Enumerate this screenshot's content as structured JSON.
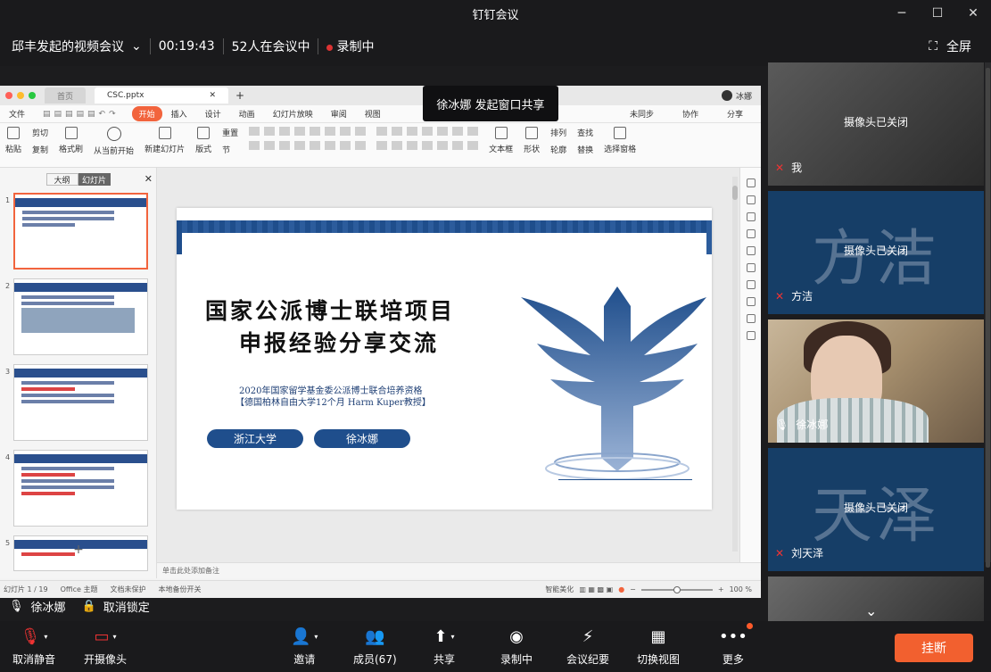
{
  "window": {
    "title": "钉钉会议",
    "controls": [
      "minimize-icon",
      "maximize-icon",
      "close-icon"
    ]
  },
  "meeting": {
    "title": "邱丰发起的视频会议",
    "elapsed": "00:19:43",
    "participants_text": "52人在会议中",
    "recording": "录制中",
    "fullscreen": "全屏"
  },
  "share_toast": "徐冰娜 发起窗口共享",
  "wps": {
    "tab_home": "首页",
    "tab_file": "CSC.pptx",
    "user": "冰娜",
    "menu": [
      "文件",
      "开始",
      "插入",
      "设计",
      "动画",
      "幻灯片放映",
      "审阅",
      "视图"
    ],
    "menu_active_index": 1,
    "menu_right": [
      "未同步",
      "协作",
      "分享"
    ],
    "ribbon": [
      "粘贴",
      "剪切",
      "复制",
      "格式刷",
      "从当前开始",
      "新建幻灯片",
      "版式",
      "节",
      "重置",
      "文本框",
      "形状",
      "排列",
      "轮廓",
      "查找",
      "替换",
      "选择窗格"
    ],
    "thumb_tabs": [
      "大纲",
      "幻灯片"
    ],
    "slide_count": "1",
    "notes_placeholder": "单击此处添加备注",
    "status": {
      "slide_pos": "幻灯片 1 / 19",
      "theme": "Office 主题",
      "doc_protect": "文档未保护",
      "backup": "本地备份开关",
      "beautify": "智能美化",
      "zoom": "100 %"
    }
  },
  "slide": {
    "title_line1": "国家公派博士联培项目",
    "title_line2": "申报经验分享交流",
    "sub1": "2020年国家留学基金委公派博士联合培养资格",
    "sub2": "【德国柏林自由大学12个月 Harm Kuper教授】",
    "pill_left": "浙江大学",
    "pill_right": "徐冰娜",
    "colors": {
      "primary": "#1f4e8c"
    }
  },
  "thumbs": [
    {
      "num": "1",
      "selected": true
    },
    {
      "num": "2",
      "selected": false
    },
    {
      "num": "3",
      "selected": false
    },
    {
      "num": "4",
      "selected": false
    },
    {
      "num": "5",
      "selected": false
    }
  ],
  "speaker": {
    "name": "徐冰娜",
    "unlock": "取消锁定"
  },
  "gallery": [
    {
      "name": "我",
      "big": "",
      "camoff": "摄像头已关闭",
      "muted": true,
      "type": "photo-dim"
    },
    {
      "name": "方洁",
      "big": "方洁",
      "camoff": "摄像头已关闭",
      "muted": true,
      "type": "avatar"
    },
    {
      "name": "徐冰娜",
      "big": "",
      "camoff": "",
      "muted": false,
      "type": "video"
    },
    {
      "name": "刘天泽",
      "big": "天泽",
      "camoff": "摄像头已关闭",
      "muted": true,
      "type": "avatar"
    }
  ],
  "toolbar": {
    "mute": "取消静音",
    "camera": "开摄像头",
    "invite": "邀请",
    "members": "成员(67)",
    "share": "共享",
    "recording": "录制中",
    "minutes": "会议纪要",
    "switch_view": "切换视图",
    "more": "更多",
    "hangup": "挂断",
    "accent": "#f2602f"
  }
}
